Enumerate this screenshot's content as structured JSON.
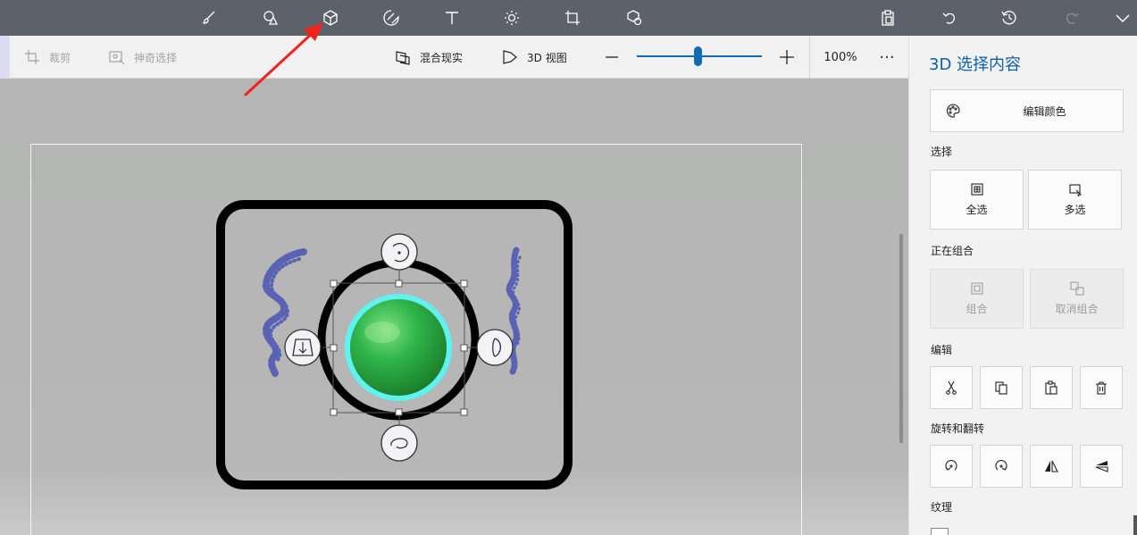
{
  "toolbar": {
    "icons": [
      "brush-icon",
      "shapes-2d-icon",
      "shapes-3d-icon",
      "stickers-icon",
      "text-icon",
      "effects-icon",
      "canvas-icon",
      "3d-library-icon"
    ],
    "right_icons": [
      "paste-icon",
      "undo-icon",
      "history-icon",
      "redo-icon",
      "expand-menu-icon"
    ]
  },
  "subbar": {
    "crop_label": "裁剪",
    "magic_select_label": "神奇选择",
    "mixed_reality_label": "混合现实",
    "view_3d_label": "3D 视图",
    "zoom_value": "100%",
    "zoom_fraction": 0.49,
    "more_label": "···"
  },
  "panel": {
    "title": "3D 选择内容",
    "edit_color_label": "编辑颜色",
    "select_section": "选择",
    "select_all_label": "全选",
    "multi_select_label": "多选",
    "group_section": "正在组合",
    "group_label": "组合",
    "ungroup_label": "取消组合",
    "edit_section": "编辑",
    "edit_icons": [
      "cut-icon",
      "copy-icon",
      "paste-icon",
      "delete-icon"
    ],
    "rotate_section": "旋转和翻转",
    "rotate_icons": [
      "rotate-left-icon",
      "rotate-right-icon",
      "flip-horizontal-icon",
      "flip-vertical-icon"
    ],
    "texture_section": "纹理"
  },
  "colors": {
    "accent": "#0f6bb8",
    "toolbar_bg": "#5d6169",
    "panel_bg": "#f2f2f2",
    "ball_green": "#2fb54a",
    "ring_cyan": "#5ef2f0",
    "scribble_blue": "#3c46b4",
    "annotation_red": "#f2231c"
  }
}
